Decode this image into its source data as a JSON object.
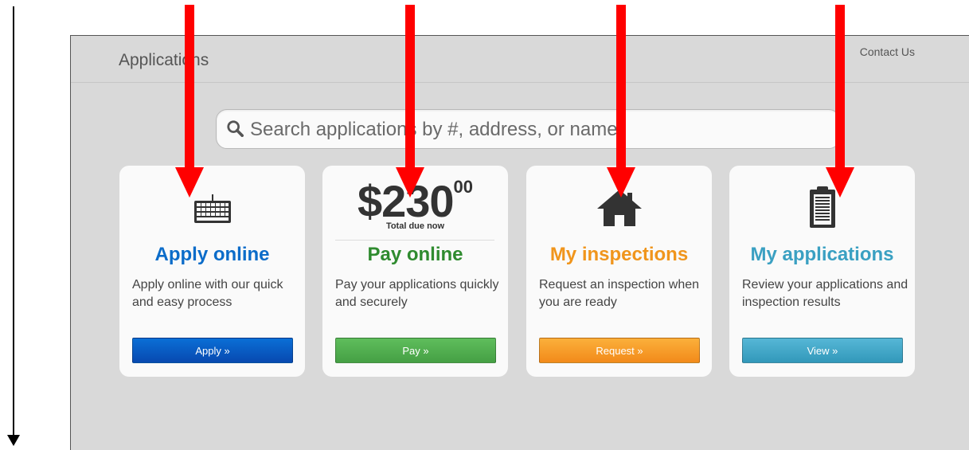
{
  "header": {
    "title": "Applications",
    "contact_label": "Contact Us"
  },
  "search": {
    "placeholder": "Search applications by #, address, or name"
  },
  "cards": [
    {
      "title": "Apply online",
      "description": "Apply online with our quick and easy process",
      "button_label": "Apply »",
      "icon": "keyboard-icon",
      "accent": "#0b6cc9"
    },
    {
      "title": "Pay online",
      "description": "Pay your applications quickly and securely",
      "button_label": "Pay »",
      "amount_main": "$230",
      "amount_cents": "00",
      "amount_caption": "Total due now",
      "accent": "#2f8b2f"
    },
    {
      "title": "My inspections",
      "description": "Request an inspection when you are ready",
      "button_label": "Request »",
      "icon": "house-icon",
      "accent": "#f0951c"
    },
    {
      "title": "My applications",
      "description": "Review your applications and inspection results",
      "button_label": "View »",
      "icon": "clipboard-icon",
      "accent": "#3aa0c2"
    }
  ],
  "annotations": {
    "arrow_color": "#ff0000",
    "scroll_arrow_color": "#000000"
  }
}
